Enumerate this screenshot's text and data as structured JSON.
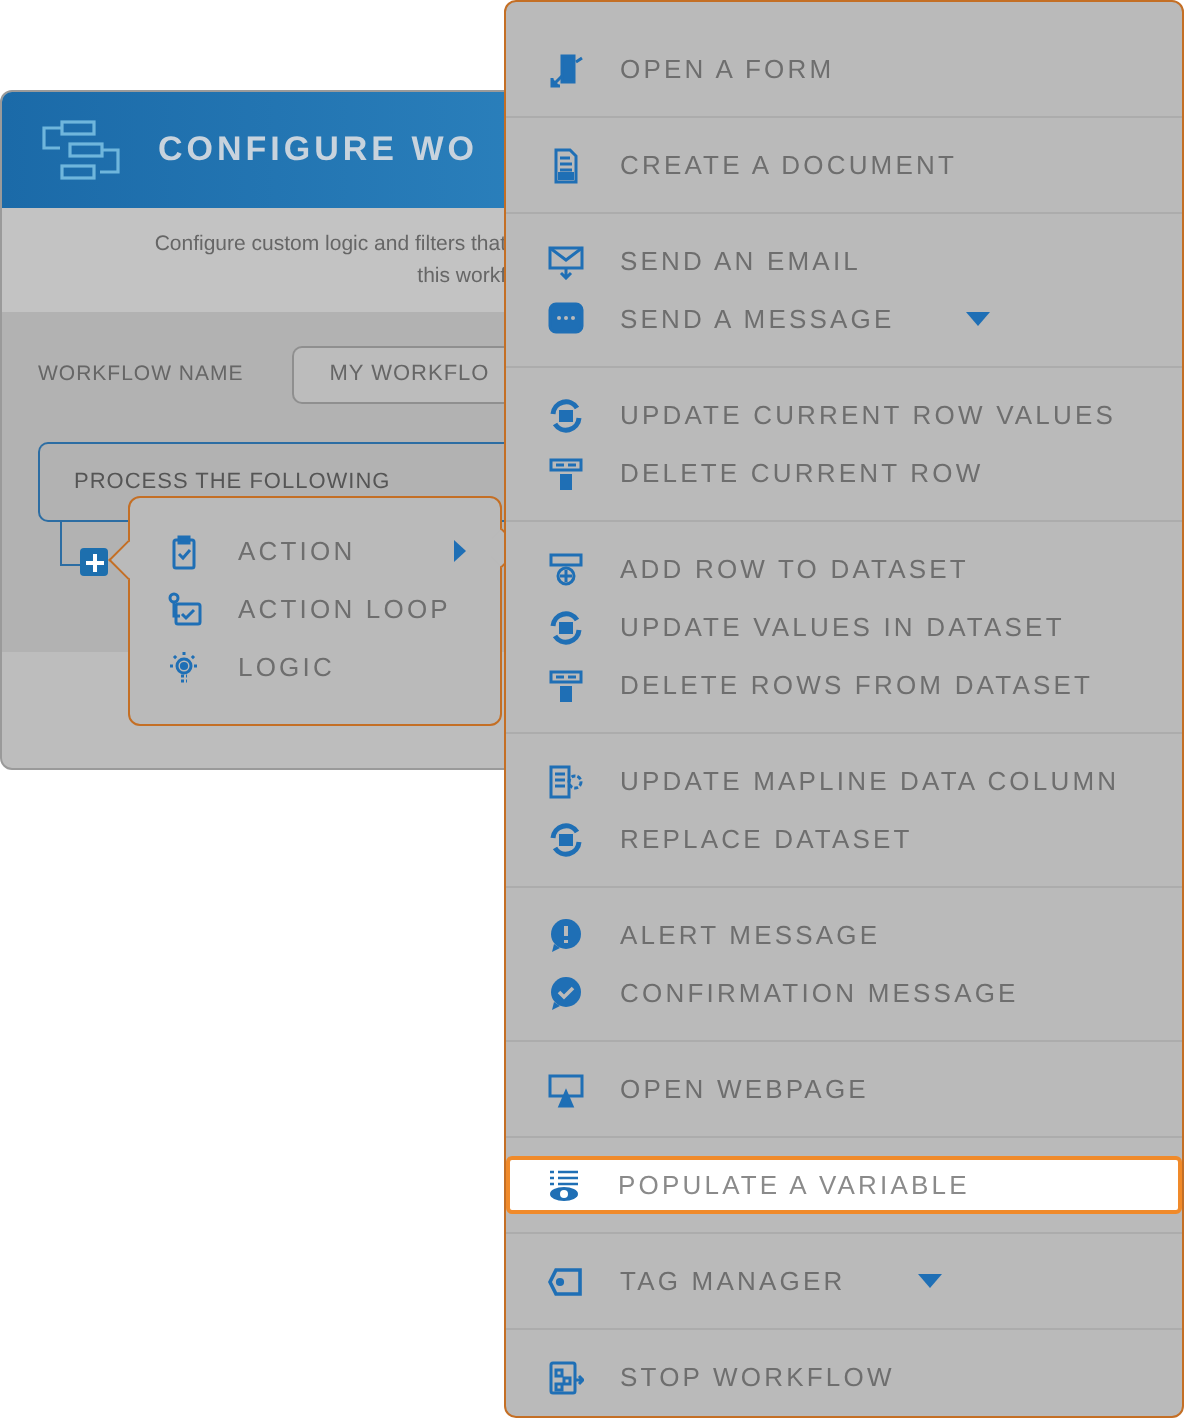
{
  "window": {
    "title": "CONFIGURE WO",
    "description": [
      "Configure custom logic and filters that",
      "this workf"
    ]
  },
  "workflow_name": {
    "label": "WORKFLOW NAME",
    "value": "MY WORKFLO"
  },
  "step": {
    "title": "PROCESS THE FOLLOWING"
  },
  "add_menu": {
    "items": [
      {
        "label": "ACTION",
        "kind": "clipboard",
        "submenu": true
      },
      {
        "label": "ACTION LOOP",
        "kind": "loop",
        "submenu": false
      },
      {
        "label": "LOGIC",
        "kind": "bulb",
        "submenu": false
      }
    ]
  },
  "action_menu": {
    "groups": [
      {
        "items": [
          {
            "label": "OPEN A FORM",
            "kind": "form",
            "dropdown": false,
            "selected": false
          }
        ]
      },
      {
        "items": [
          {
            "label": "CREATE A DOCUMENT",
            "kind": "pdf",
            "dropdown": false,
            "selected": false
          }
        ]
      },
      {
        "items": [
          {
            "label": "SEND AN EMAIL",
            "kind": "email",
            "dropdown": false,
            "selected": false
          },
          {
            "label": "SEND A MESSAGE",
            "kind": "chat",
            "dropdown": true,
            "selected": false
          }
        ]
      },
      {
        "items": [
          {
            "label": "UPDATE CURRENT ROW VALUES",
            "kind": "refresh",
            "dropdown": false,
            "selected": false
          },
          {
            "label": "DELETE CURRENT ROW",
            "kind": "trash",
            "dropdown": false,
            "selected": false
          }
        ]
      },
      {
        "items": [
          {
            "label": "ADD ROW TO DATASET",
            "kind": "addrow",
            "dropdown": false,
            "selected": false
          },
          {
            "label": "UPDATE VALUES IN DATASET",
            "kind": "refresh",
            "dropdown": false,
            "selected": false
          },
          {
            "label": "DELETE ROWS FROM DATASET",
            "kind": "trash",
            "dropdown": false,
            "selected": false
          }
        ]
      },
      {
        "items": [
          {
            "label": "UPDATE MAPLINE DATA COLUMN",
            "kind": "gear",
            "dropdown": false,
            "selected": false
          },
          {
            "label": "REPLACE DATASET",
            "kind": "refresh",
            "dropdown": false,
            "selected": false
          }
        ]
      },
      {
        "items": [
          {
            "label": "ALERT MESSAGE",
            "kind": "alert",
            "dropdown": false,
            "selected": false
          },
          {
            "label": "CONFIRMATION MESSAGE",
            "kind": "confirm",
            "dropdown": false,
            "selected": false
          }
        ]
      },
      {
        "items": [
          {
            "label": "OPEN WEBPAGE",
            "kind": "monitor",
            "dropdown": false,
            "selected": false
          }
        ]
      },
      {
        "items": [
          {
            "label": "POPULATE A VARIABLE",
            "kind": "eye",
            "dropdown": false,
            "selected": true
          }
        ]
      },
      {
        "items": [
          {
            "label": "TAG MANAGER",
            "kind": "tag",
            "dropdown": true,
            "selected": false
          }
        ]
      },
      {
        "items": [
          {
            "label": "STOP WORKFLOW",
            "kind": "stop",
            "dropdown": false,
            "selected": false
          }
        ]
      }
    ]
  }
}
